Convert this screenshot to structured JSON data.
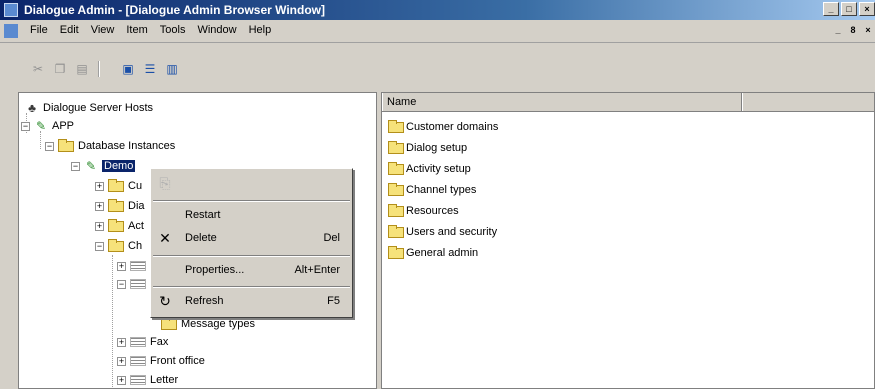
{
  "window": {
    "title": "Dialogue Admin - [Dialogue Admin Browser Window]",
    "controls": [
      "_",
      "□",
      "×"
    ],
    "doc_controls": [
      "_",
      "8",
      "×"
    ]
  },
  "menu": [
    "File",
    "Edit",
    "View",
    "Item",
    "Tools",
    "Window",
    "Help"
  ],
  "toolbar": {
    "icons": [
      "cut-icon",
      "copy-icon",
      "paste-icon",
      "page-icon",
      "list-icon",
      "details-icon"
    ]
  },
  "tree": {
    "root": "Dialogue Server Hosts",
    "app": "APP",
    "db_instances": "Database Instances",
    "demo": "Demo",
    "partial": [
      "Cu",
      "Dia",
      "Act",
      "Ch"
    ],
    "message_types": "Message types",
    "fax": "Fax",
    "front_office": "Front office",
    "letter": "Letter"
  },
  "list": {
    "header": "Name",
    "rows": [
      "Customer domains",
      "Dialog setup",
      "Activity setup",
      "Channel types",
      "Resources",
      "Users and security",
      "General admin"
    ]
  },
  "context_menu": {
    "first": {
      "label": "",
      "key": ""
    },
    "restart": "Restart",
    "delete": {
      "label": "Delete",
      "key": "Del"
    },
    "properties": {
      "label": "Properties...",
      "key": "Alt+Enter"
    },
    "refresh": {
      "label": "Refresh",
      "key": "F5"
    }
  },
  "colors": {
    "selection": "#0a246a",
    "folder": "#f6e27a",
    "titlebar": "#0a246a"
  }
}
